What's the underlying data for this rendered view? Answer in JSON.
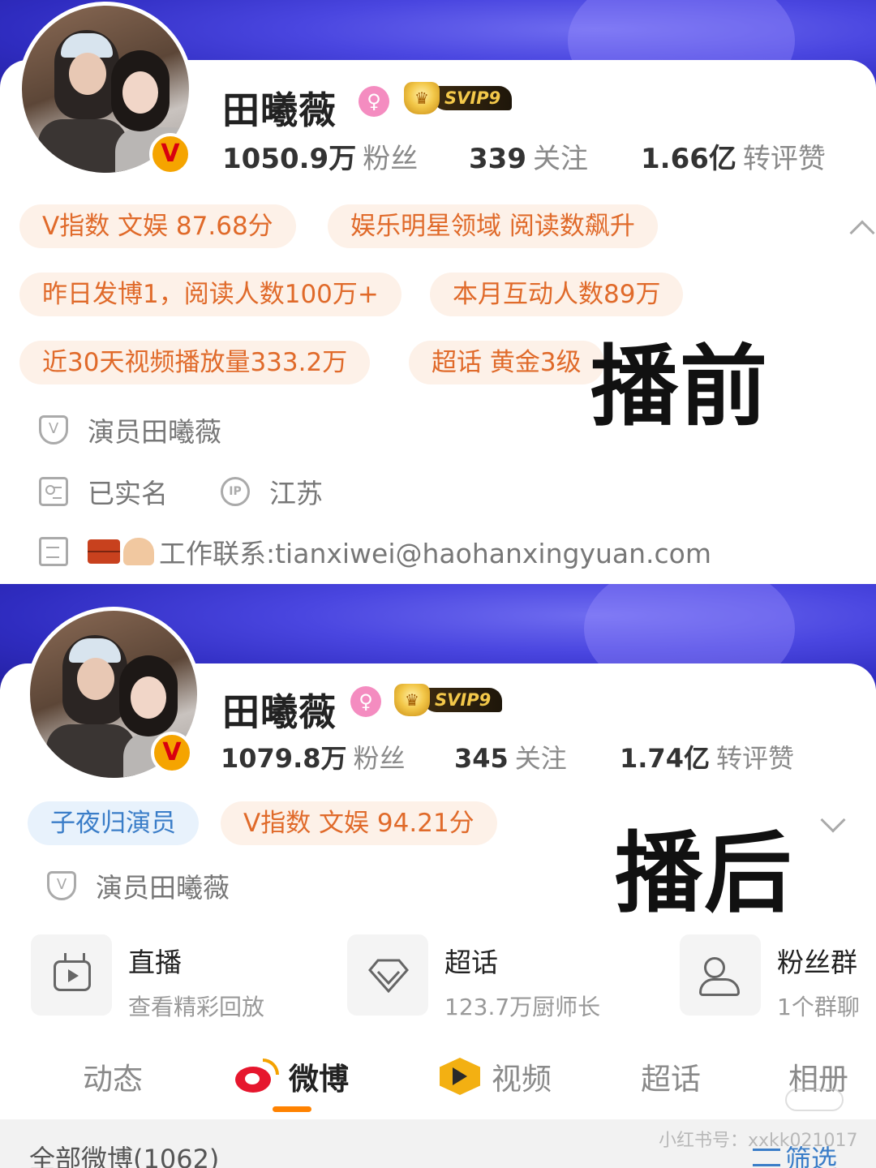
{
  "before": {
    "name": "田曦薇",
    "gender_symbol": "♀",
    "vip_label": "SVIP9",
    "verified_badge": "V",
    "stats": [
      {
        "num": "1050.9万",
        "label": "粉丝"
      },
      {
        "num": "339",
        "label": "关注"
      },
      {
        "num": "1.66亿",
        "label": "转评赞"
      }
    ],
    "chips_row1": [
      "V指数 文娱 87.68分",
      "娱乐明星领域 阅读数飙升"
    ],
    "chips_row2": [
      "昨日发博1，阅读人数100万+",
      "本月互动人数89万"
    ],
    "chips_row3": [
      "近30天视频播放量333.2万",
      "超话 黄金3级"
    ],
    "verification": "演员田曦薇",
    "real_name": "已实名",
    "ip_icon_text": "IP",
    "ip_location": "江苏",
    "contact": "工作联系:tianxiwei@haohanxingyuan.com",
    "overlay_label": "播前"
  },
  "after": {
    "name": "田曦薇",
    "gender_symbol": "♀",
    "vip_label": "SVIP9",
    "verified_badge": "V",
    "stats": [
      {
        "num": "1079.8万",
        "label": "粉丝"
      },
      {
        "num": "345",
        "label": "关注"
      },
      {
        "num": "1.74亿",
        "label": "转评赞"
      }
    ],
    "chip_blue": "子夜归演员",
    "chip_orange": "V指数 文娱 94.21分",
    "verification": "演员田曦薇",
    "overlay_label": "播后",
    "entries": [
      {
        "title": "直播",
        "sub": "查看精彩回放",
        "icon": "tv-icon"
      },
      {
        "title": "超话",
        "sub": "123.7万厨师长",
        "icon": "diamond-icon"
      },
      {
        "title": "粉丝群",
        "sub": "1个群聊",
        "icon": "group-icon"
      }
    ],
    "tabs": [
      "动态",
      "微博",
      "视频",
      "超话",
      "相册"
    ],
    "active_tab": "微博",
    "all_posts": "全部微博(1062)",
    "filter": "筛选",
    "watermark": "小红书号：xxkk021017"
  },
  "colors": {
    "banner": "#4a46e0",
    "chip_orange_text": "#e06a2a",
    "chip_blue_text": "#3a7dc8",
    "tab_indicator": "#ff8200"
  }
}
